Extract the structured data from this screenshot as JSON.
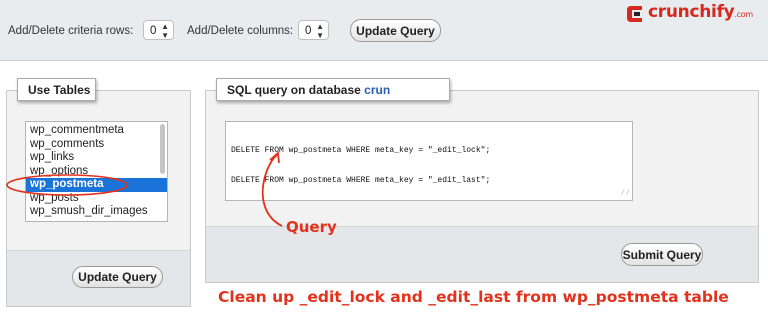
{
  "toolbar": {
    "criteria_label": "Add/Delete criteria rows:",
    "criteria_value": "0",
    "columns_label": "Add/Delete columns:",
    "columns_value": "0",
    "update_label": "Update Query"
  },
  "brand": {
    "name": "crunchify",
    "suffix": ".com"
  },
  "use_tables": {
    "legend": "Use Tables",
    "items": [
      "wp_commentmeta",
      "wp_comments",
      "wp_links",
      "wp_options",
      "wp_postmeta",
      "wp_posts",
      "wp_smush_dir_images"
    ],
    "selected": "wp_postmeta",
    "update_label": "Update Query"
  },
  "sql_panel": {
    "legend_prefix": "SQL query on database ",
    "database": "crun",
    "query_lines": [
      "DELETE FROM wp_postmeta WHERE meta_key = \"_edit_lock\";",
      "DELETE FROM wp_postmeta WHERE meta_key = \"_edit_last\";"
    ],
    "submit_label": "Submit Query"
  },
  "annotations": {
    "query_note": "Query",
    "caption": "Clean up _edit_lock and _edit_last from wp_postmeta table",
    "color": "#e2321b"
  },
  "colors": {
    "accent": "#e2321b",
    "selection": "#1a73d9",
    "brand": "#d7281e"
  }
}
